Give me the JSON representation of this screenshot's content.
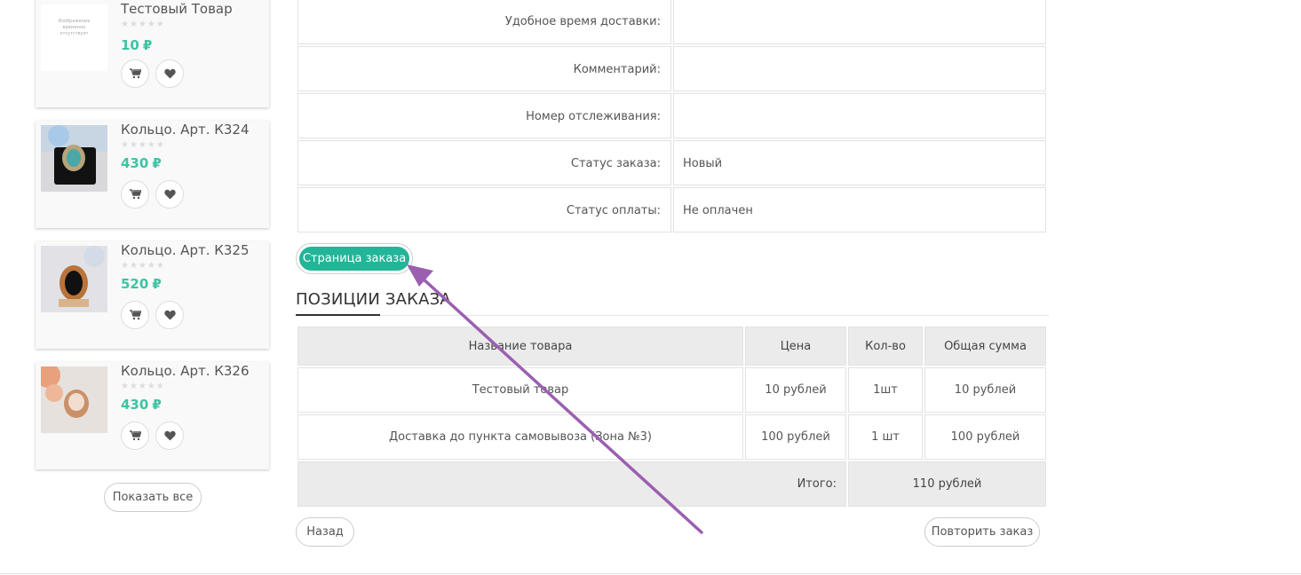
{
  "sidebar": {
    "products": [
      {
        "title": "Тестовый Товар",
        "price": "10",
        "currency": "₽",
        "rating": 0,
        "thumb_text": "Изображение временно отсутствует"
      },
      {
        "title": "Кольцо. Арт. К324",
        "price": "430",
        "currency": "₽",
        "rating": 0
      },
      {
        "title": "Кольцо. Арт. К325",
        "price": "520",
        "currency": "₽",
        "rating": 0
      },
      {
        "title": "Кольцо. Арт. К326",
        "price": "430",
        "currency": "₽",
        "rating": 0
      }
    ],
    "show_all_label": "Показать все"
  },
  "order_info": {
    "rows": [
      {
        "label": "Удобное время доставки:",
        "value": ""
      },
      {
        "label": "Комментарий:",
        "value": ""
      },
      {
        "label": "Номер отслеживания:",
        "value": ""
      },
      {
        "label": "Статус заказа:",
        "value": "Новый"
      },
      {
        "label": "Статус оплаты:",
        "value": "Не оплачен"
      }
    ]
  },
  "order_page_button": "Страница заказа",
  "section_title": "ПОЗИЦИИ ЗАКАЗА",
  "items_table": {
    "headers": [
      "Название товара",
      "Цена",
      "Кол-во",
      "Общая сумма"
    ],
    "rows": [
      [
        "Тестовый товар",
        "10 рублей",
        "1шт",
        "10 рублей"
      ],
      [
        "Доставка до пункта самовывоза (Зона №3)",
        "100 рублей",
        "1 шт",
        "100 рублей"
      ]
    ],
    "total_label": "Итого:",
    "total_value": "110 рублей"
  },
  "actions": {
    "back": "Назад",
    "repeat": "Повторить заказ"
  },
  "colors": {
    "accent": "#22b598",
    "price": "#3ec3a4",
    "annotation_arrow": "#9b5fb0"
  }
}
